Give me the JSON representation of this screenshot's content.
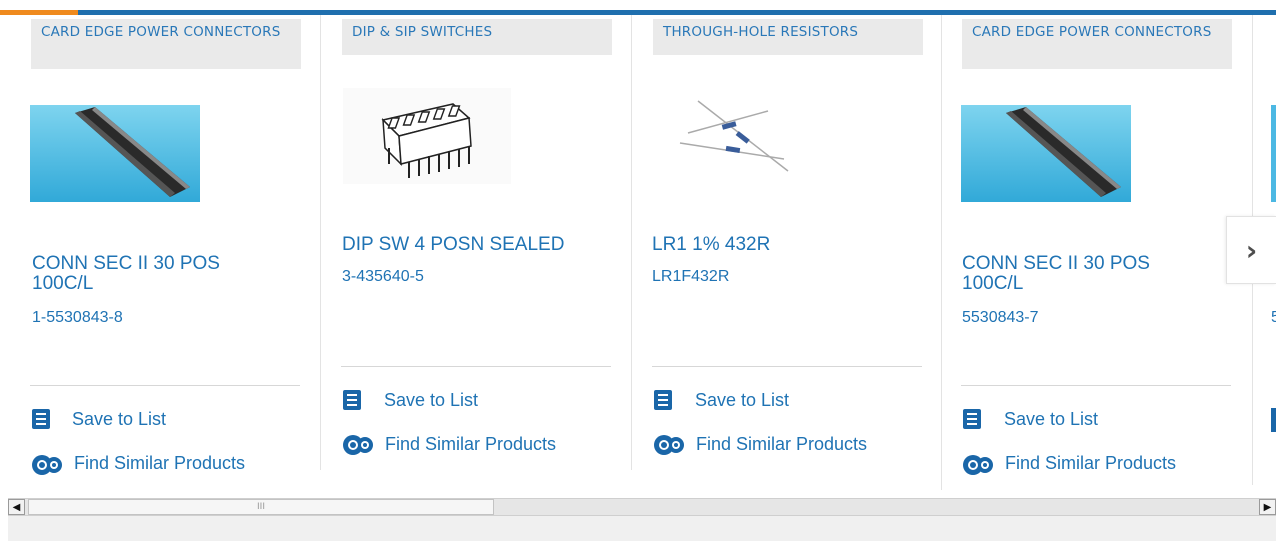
{
  "products": [
    {
      "category": "CARD EDGE POWER CONNECTORS",
      "title": "CONN SEC II 30 POS 100C/L",
      "part_number": "1-5530843-8",
      "image": "card-edge-connector-image",
      "save_label": "Save to List",
      "similar_label": "Find Similar Products"
    },
    {
      "category": "DIP & SIP SWITCHES",
      "title": "DIP SW 4 POSN SEALED",
      "part_number": "3-435640-5",
      "image": "dip-switch-image",
      "save_label": "Save to List",
      "similar_label": "Find Similar Products"
    },
    {
      "category": "THROUGH-HOLE RESISTORS",
      "title": "LR1 1% 432R",
      "part_number": "LR1F432R",
      "image": "resistor-image",
      "save_label": "Save to List",
      "similar_label": "Find Similar Products"
    },
    {
      "category": "CARD EDGE POWER CONNECTORS",
      "title": "CONN SEC II 30 POS 100C/L",
      "part_number": "5530843-7",
      "image": "card-edge-connector-image",
      "save_label": "Save to List",
      "similar_label": "Find Similar Products"
    }
  ],
  "partial_card": {
    "part_number_prefix": "5"
  },
  "carousel": {
    "next_icon": "chevron-right-icon",
    "next_glyph": "›"
  },
  "scrollbar": {
    "left_arrow": "◀",
    "right_arrow": "▶",
    "grip": "III"
  },
  "colors": {
    "accent_orange": "#ef8a1e",
    "brand_blue": "#1f6fae",
    "link_blue": "#1f73b4"
  }
}
